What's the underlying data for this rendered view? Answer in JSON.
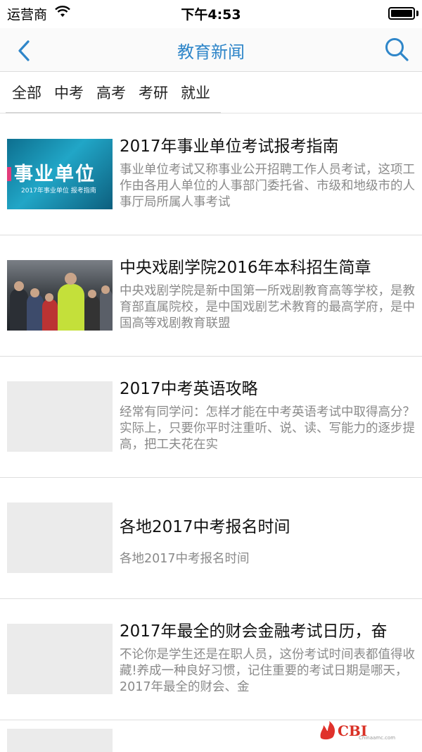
{
  "status_bar": {
    "carrier": "运营商",
    "time": "下午4:53",
    "icons": [
      "wifi-icon",
      "battery-icon"
    ]
  },
  "nav": {
    "title": "教育新闻",
    "back_icon": "chevron-left-icon",
    "search_icon": "search-icon",
    "accent_color": "#2f86c9"
  },
  "tabs": [
    {
      "label": "全部"
    },
    {
      "label": "中考"
    },
    {
      "label": "高考"
    },
    {
      "label": "考研"
    },
    {
      "label": "就业"
    }
  ],
  "articles": [
    {
      "title": "2017年事业单位考试报考指南",
      "summary": "事业单位考试又称事业公开招聘工作人员考试，这项工作由各用人单位的人事部门委托省、市级和地级市的人事厅局所属人事考试",
      "thumb": {
        "type": "banner",
        "text": "事业单位",
        "subtext": "2017年事业单位 报考指南"
      }
    },
    {
      "title": "中央戏剧学院2016年本科招生简章",
      "summary": "中央戏剧学院是新中国第一所戏剧教育高等学校，是教育部直属院校，是中国戏剧艺术教育的最高学府，是中国高等戏剧教育联盟",
      "thumb": {
        "type": "photo"
      }
    },
    {
      "title": "2017中考英语攻略",
      "summary": "经常有同学问：怎样才能在中考英语考试中取得高分？实际上，只要你平时注重听、说、读、写能力的逐步提高，把工夫花在实",
      "thumb": {
        "type": "placeholder"
      }
    },
    {
      "title": "各地2017中考报名时间",
      "summary": "各地2017中考报名时间",
      "thumb": {
        "type": "placeholder"
      }
    },
    {
      "title": "2017年最全的财会金融考试日历，奋",
      "summary": "不论你是学生还是在职人员，这份考试时间表都值得收藏!养成一种良好习惯，记住重要的考试日期是哪天，2017年最全的财会、金",
      "thumb": {
        "type": "placeholder"
      }
    }
  ],
  "watermark": {
    "text": "CBI",
    "subtext": "Chinaamc.com"
  }
}
